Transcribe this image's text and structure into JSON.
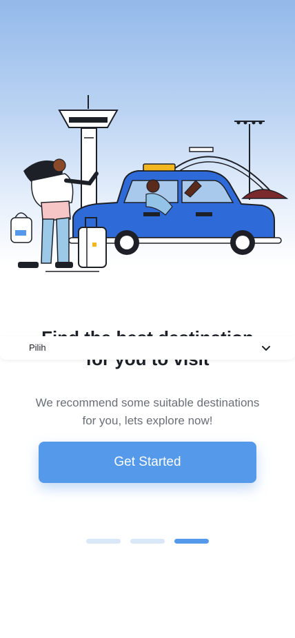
{
  "colors": {
    "accent": "#5599ea",
    "dot_inactive": "#d9e7f8",
    "dot_active": "#5599ea",
    "title": "#1e2027",
    "subtitle": "#6b6e76"
  },
  "illustration": {
    "icon": "traveler-taxi-airport-illustration"
  },
  "onboarding": {
    "title_line1": "Find the best destination",
    "title_line2": "for you to visit",
    "subtitle": "We recommend some suitable destinations for you, lets explore now!",
    "cta_label": "Get Started"
  },
  "dropdown": {
    "selected_value": "Pilih",
    "icon": "chevron-down-icon"
  },
  "pagination": {
    "total": 3,
    "active_index": 2
  }
}
